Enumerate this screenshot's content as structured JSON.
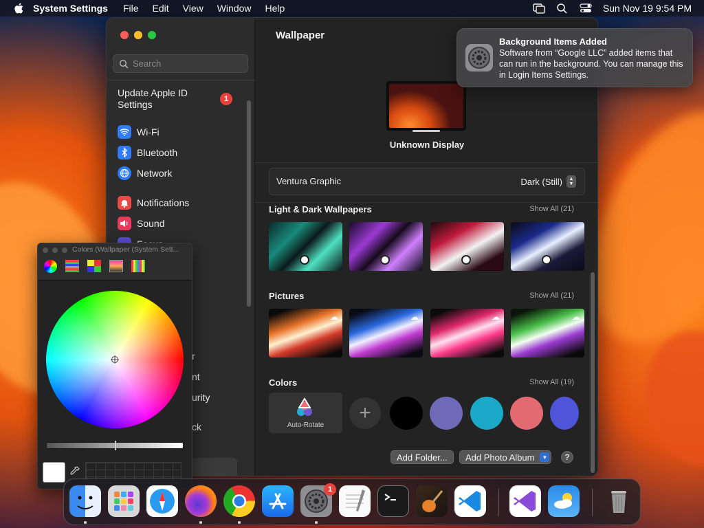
{
  "menubar": {
    "app_name": "System Settings",
    "items": [
      "File",
      "Edit",
      "View",
      "Window",
      "Help"
    ],
    "datetime": "Sun Nov 19  9:54 PM"
  },
  "settings": {
    "search_placeholder": "Search",
    "apple_id_label": "Update Apple ID Settings",
    "apple_id_badge": "1",
    "sidebar_items": [
      {
        "label": "Wi-Fi",
        "icon": "wifi-icon",
        "color": "#2f7cf6"
      },
      {
        "label": "Bluetooth",
        "icon": "bluetooth-icon",
        "color": "#2f7cf6"
      },
      {
        "label": "Network",
        "icon": "globe-icon",
        "color": "#2f7cf6"
      },
      {
        "label": "Notifications",
        "icon": "bell-icon",
        "color": "#ea4a45"
      },
      {
        "label": "Sound",
        "icon": "speaker-icon",
        "color": "#ea3a5e"
      },
      {
        "label": "Focus",
        "icon": "moon-icon",
        "color": "#5a4fd6"
      }
    ],
    "partial_items": [
      "r",
      "nt",
      "urity",
      "ck"
    ],
    "title": "Wallpaper",
    "display_name": "Unknown Display",
    "wallpaper_name": "Ventura Graphic",
    "wallpaper_mode": "Dark (Still)",
    "sections": {
      "light_dark": {
        "title": "Light & Dark Wallpapers",
        "show_all": "Show All (21)"
      },
      "pictures": {
        "title": "Pictures",
        "show_all": "Show All (21)"
      },
      "colors": {
        "title": "Colors",
        "show_all": "Show All (19)"
      }
    },
    "auto_rotate_label": "Auto-Rotate",
    "color_swatches": [
      "#000000",
      "#6e6ab8",
      "#1aa9c8",
      "#e46a72",
      "#4e55d8"
    ],
    "add_folder_label": "Add Folder...",
    "add_photo_album_label": "Add Photo Album",
    "help_label": "?"
  },
  "notification": {
    "title": "Background Items Added",
    "body": "Software from “Google LLC” added items that can run in the background. You can manage this in Login Items Settings."
  },
  "colors_panel": {
    "title": "Colors (Wallpaper (System Sett..."
  },
  "dock": {
    "apps": [
      {
        "name": "finder-icon",
        "running": true
      },
      {
        "name": "launchpad-icon",
        "running": false
      },
      {
        "name": "safari-icon",
        "running": false
      },
      {
        "name": "firefox-icon",
        "running": true
      },
      {
        "name": "chrome-icon",
        "running": true
      },
      {
        "name": "app-store-icon",
        "running": false
      },
      {
        "name": "system-settings-icon",
        "running": true,
        "badge": "1"
      },
      {
        "name": "textedit-icon",
        "running": false
      },
      {
        "name": "terminal-icon",
        "running": false
      },
      {
        "name": "garageband-icon",
        "running": false
      },
      {
        "name": "vscode-icon",
        "running": false
      },
      {
        "name": "visual-studio-icon",
        "running": false
      },
      {
        "name": "weather-icon",
        "running": false
      },
      {
        "name": "trash-icon",
        "running": false
      }
    ]
  }
}
